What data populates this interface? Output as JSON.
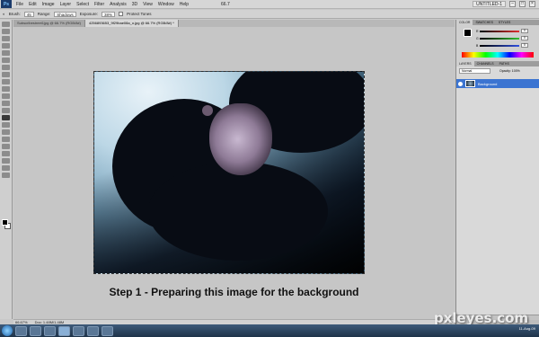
{
  "menubar": {
    "logo": "Ps",
    "items": [
      "File",
      "Edit",
      "Image",
      "Layer",
      "Select",
      "Filter",
      "Analysis",
      "3D",
      "View",
      "Window",
      "Help"
    ],
    "zoom": "66.7",
    "mode": "UNTITLED-1"
  },
  "options": {
    "brush_label": "Brush:",
    "brush_size": "45",
    "range_label": "Range:",
    "range_value": "Shadows",
    "exposure_label": "Exposure:",
    "exposure_value": "38%",
    "protect_label": "Protect Tones"
  },
  "tabs": [
    {
      "label": "Subscribestreet1jpg @ 66.7% (RGB/8#)"
    },
    {
      "label": "4256893653_9f29bae08a_o.jpg @ 66.7% (RGB/8#) *"
    }
  ],
  "canvas": {
    "caption": "Step 1 - Preparing this image for the background"
  },
  "status": {
    "zoom": "66.67%",
    "doc": "Doc: 1.48M/1.48M"
  },
  "panels": {
    "color_tabs": [
      "COLOR",
      "SWATCHES",
      "STYLES"
    ],
    "rgb": [
      {
        "channel": "R",
        "value": "0",
        "color": "#e03030"
      },
      {
        "channel": "G",
        "value": "0",
        "color": "#30c030"
      },
      {
        "channel": "B",
        "value": "0",
        "color": "#3050e0"
      }
    ],
    "layer_tabs": [
      "LAYERS",
      "CHANNELS",
      "PATHS"
    ],
    "blend_mode": "Normal",
    "opacity": "Opacity: 100%",
    "layer_name": "Background"
  },
  "watermark": "pxleyes.com",
  "taskbar": {
    "clock_time": "...",
    "clock_date": "11-Aug-09"
  },
  "colors": {
    "layer_selected": "#3b74d1",
    "taskbar": "#1e3349"
  }
}
